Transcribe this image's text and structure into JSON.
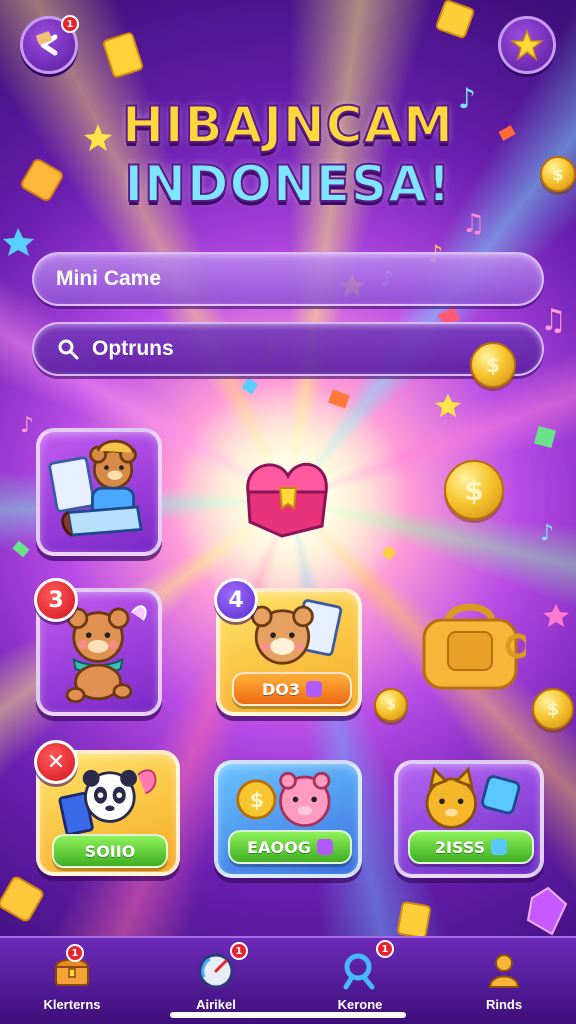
{
  "title": {
    "line1": "HIBAJNCAM",
    "line2": "INDONESA!"
  },
  "menu": {
    "mini_game_label": "Mini Came",
    "options_label": "Optruns"
  },
  "header": {
    "back_badge": "1"
  },
  "tiles": [
    {
      "id": "tile-1",
      "badge": "",
      "price": ""
    },
    {
      "id": "tile-2",
      "badge": "3",
      "price": ""
    },
    {
      "id": "tile-3",
      "badge": "4",
      "price": "DO3"
    },
    {
      "id": "tile-4",
      "badge": "✕",
      "price": "SOIIO"
    },
    {
      "id": "tile-5",
      "badge": "",
      "price": "EAOOG"
    },
    {
      "id": "tile-6",
      "badge": "",
      "price": "2ISSS"
    }
  ],
  "nav": {
    "items": [
      {
        "label": "Klerterns",
        "icon": "treasure-chest-icon",
        "badge": "1"
      },
      {
        "label": "Airikel",
        "icon": "gauge-icon",
        "badge": "1"
      },
      {
        "label": "Kerone",
        "icon": "magnifier-icon",
        "badge": "1"
      },
      {
        "label": "Rinds",
        "icon": "person-icon",
        "badge": ""
      }
    ]
  },
  "colors": {
    "bg_dark": "#3d0f7a",
    "accent_yellow": "#ffd83a",
    "accent_cyan": "#7ee6ff",
    "badge_red": "#d3141f",
    "price_green": "#3fae22",
    "price_orange": "#ee6a14"
  }
}
